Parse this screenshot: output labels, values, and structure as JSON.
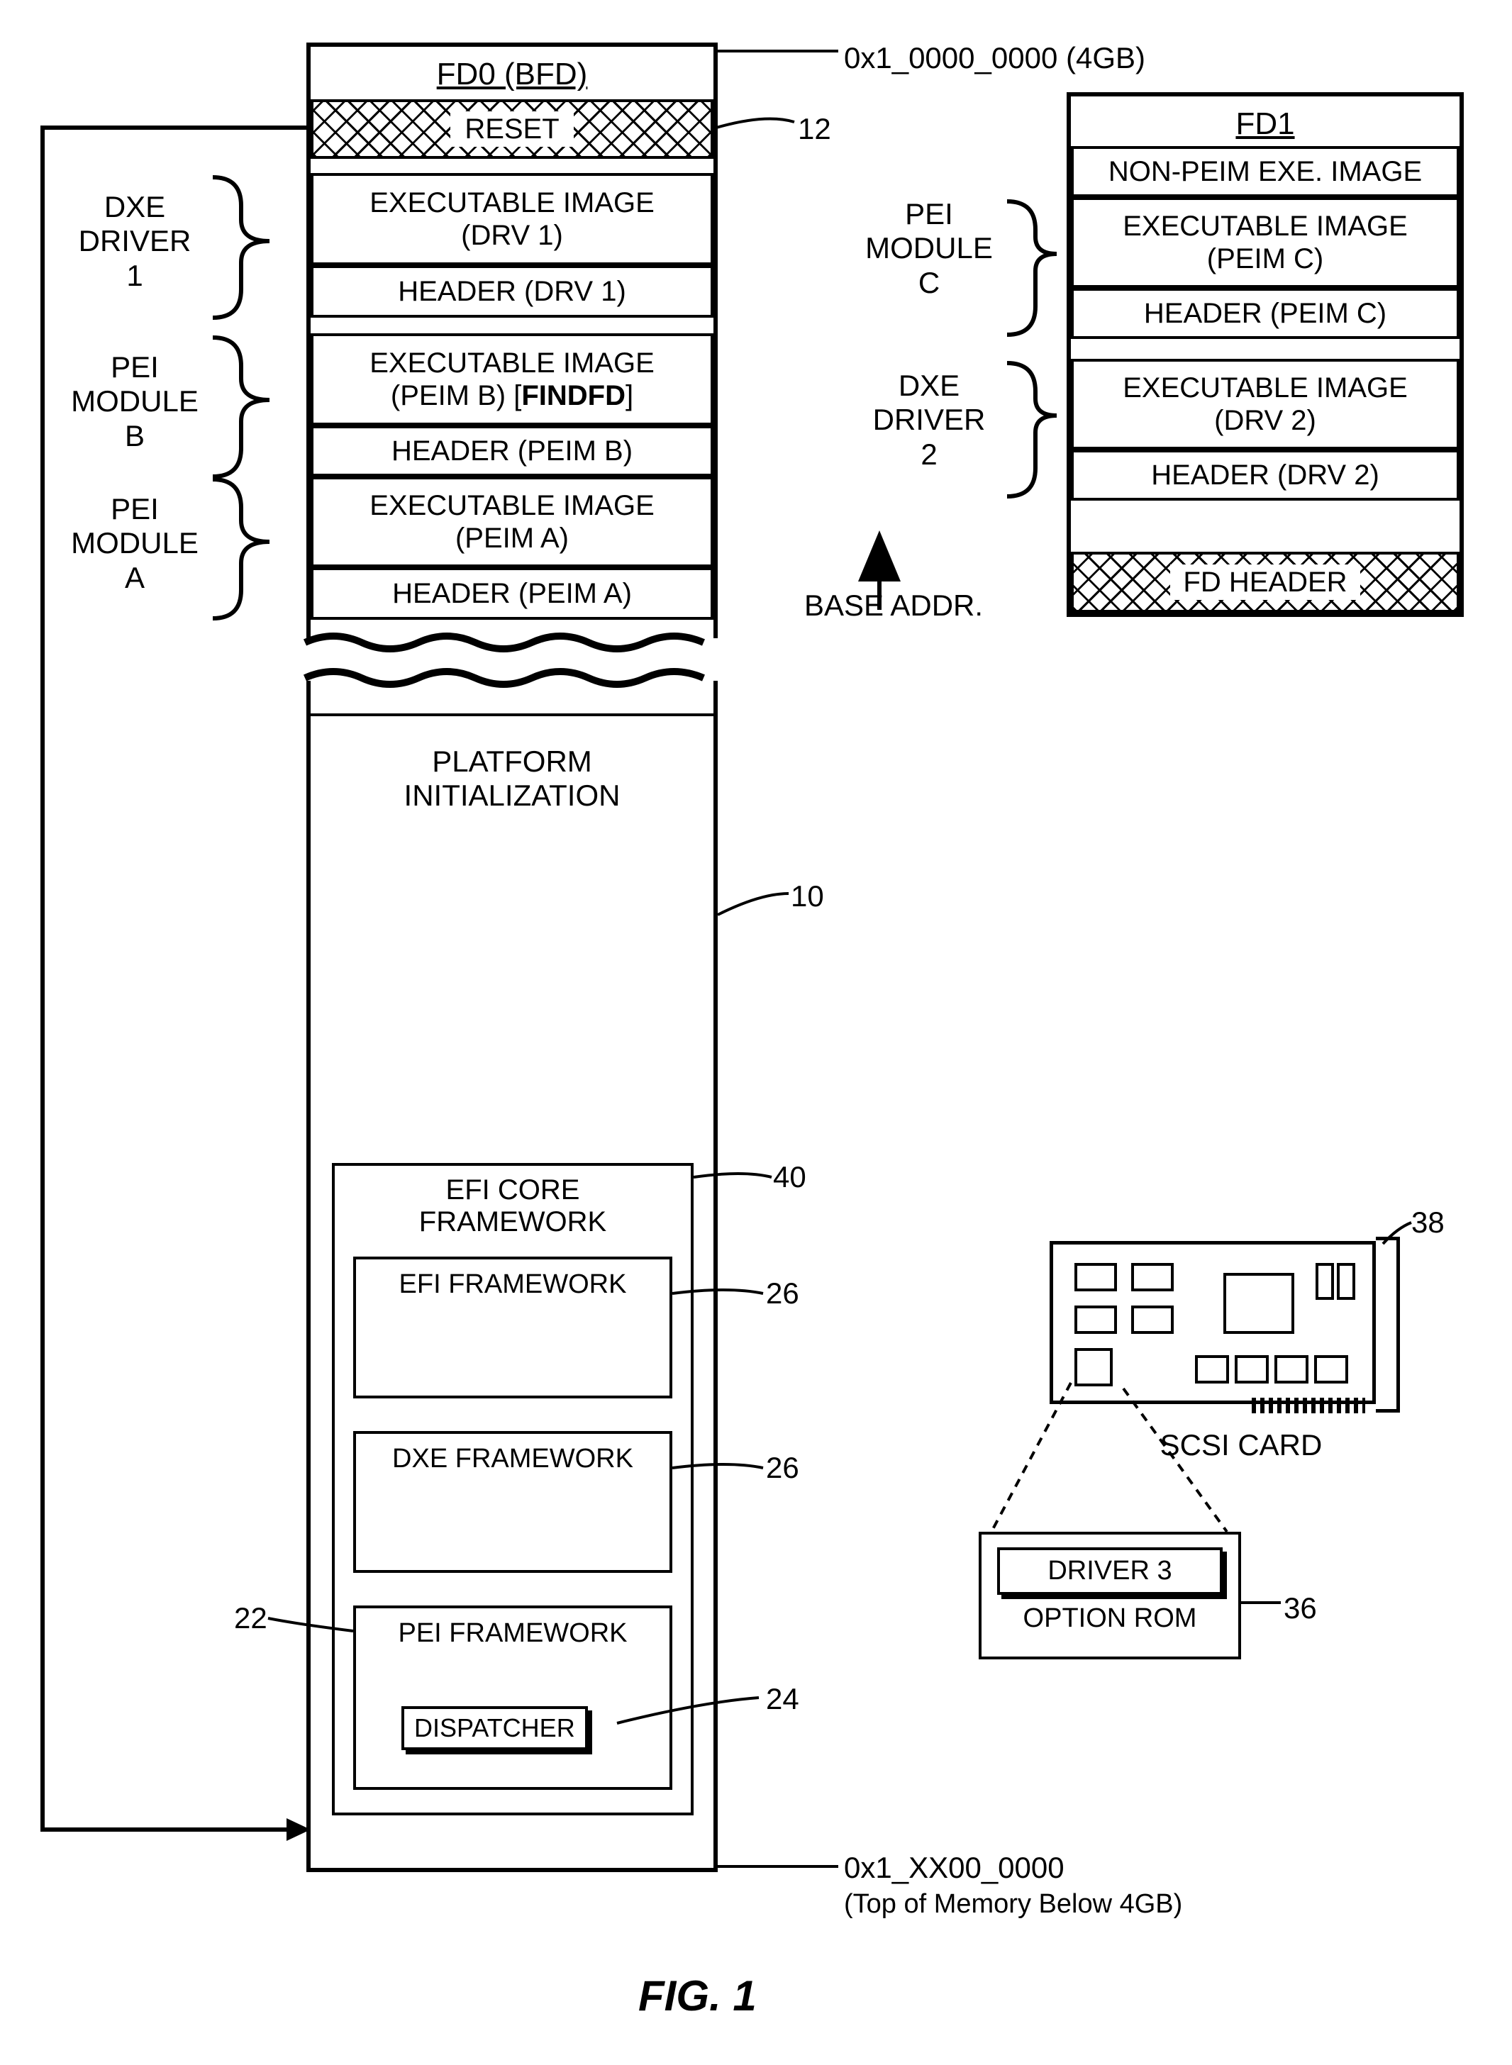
{
  "addresses": {
    "top": "0x1_0000_0000 (4GB)",
    "bottom_hex": "0x1_XX00_0000",
    "bottom_note": "(Top of Memory Below 4GB)",
    "base_addr": "BASE ADDR."
  },
  "fd0": {
    "title": "FD0 (BFD)",
    "reset": "RESET",
    "drv1_exec": "EXECUTABLE IMAGE\n(DRV 1)",
    "drv1_hdr": "HEADER (DRV 1)",
    "peimb_exec": "EXECUTABLE IMAGE\n(PEIM B) [FINDFD]",
    "peimb_hdr": "HEADER (PEIM B)",
    "peima_exec": "EXECUTABLE IMAGE\n(PEIM A)",
    "peima_hdr": "HEADER (PEIM A)",
    "platform_init": "PLATFORM\nINITIALIZATION",
    "efi_core": "EFI CORE\nFRAMEWORK",
    "efi_fw": "EFI FRAMEWORK",
    "dxe_fw": "DXE FRAMEWORK",
    "pei_fw": "PEI FRAMEWORK",
    "dispatcher": "DISPATCHER"
  },
  "fd1": {
    "title": "FD1",
    "nonpeim": "NON-PEIM EXE. IMAGE",
    "peimc_exec": "EXECUTABLE IMAGE\n(PEIM C)",
    "peimc_hdr": "HEADER (PEIM C)",
    "drv2_exec": "EXECUTABLE IMAGE\n(DRV 2)",
    "drv2_hdr": "HEADER (DRV 2)",
    "fd_hdr": "FD HEADER"
  },
  "left_labels": {
    "dxe1": "DXE\nDRIVER\n1",
    "peib": "PEI\nMODULE\nB",
    "peia": "PEI\nMODULE\nA"
  },
  "mid_labels": {
    "peic": "PEI\nMODULE\nC",
    "dxe2": "DXE\nDRIVER\n2"
  },
  "callouts": {
    "c12": "12",
    "c10": "10",
    "c40": "40",
    "c26a": "26",
    "c26b": "26",
    "c22": "22",
    "c24": "24",
    "c38": "38",
    "c36": "36"
  },
  "scsi": {
    "label": "SCSI CARD",
    "driver3": "DRIVER 3",
    "option_rom": "OPTION ROM"
  },
  "figure": "FIG. 1",
  "findfd_bold": "FINDFD"
}
